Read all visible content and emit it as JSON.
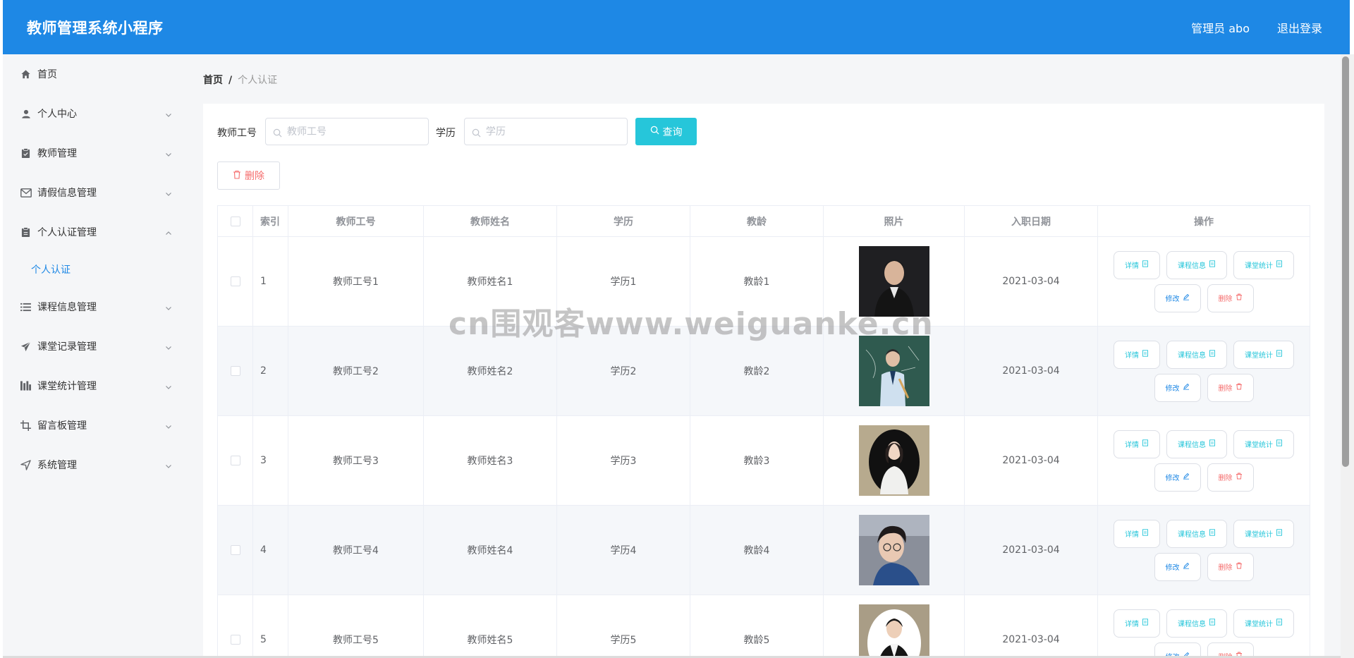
{
  "header": {
    "app_title": "教师管理系统小程序",
    "user_label": "管理员 abo",
    "logout_label": "退出登录",
    "bg_color": "#1e88e5"
  },
  "sidebar": {
    "items": [
      {
        "label": "首页",
        "icon": "home-icon"
      },
      {
        "label": "个人中心",
        "icon": "user-icon"
      },
      {
        "label": "教师管理",
        "icon": "clipboard-icon"
      },
      {
        "label": "请假信息管理",
        "icon": "mail-icon"
      },
      {
        "label": "个人认证管理",
        "icon": "clipboard-icon"
      },
      {
        "label": "课程信息管理",
        "icon": "list-icon"
      },
      {
        "label": "课堂记录管理",
        "icon": "send-icon"
      },
      {
        "label": "课堂统计管理",
        "icon": "bar-chart-icon"
      },
      {
        "label": "留言板管理",
        "icon": "crop-icon"
      },
      {
        "label": "系统管理",
        "icon": "navigation-icon"
      }
    ],
    "submenu_active": "个人认证"
  },
  "breadcrumb": {
    "home": "首页",
    "separator": "/",
    "current": "个人认证"
  },
  "search": {
    "teacher_no_label": "教师工号",
    "teacher_no_placeholder": "教师工号",
    "education_label": "学历",
    "education_placeholder": "学历",
    "query_button": "查询",
    "delete_button": "删除"
  },
  "table": {
    "columns": [
      "索引",
      "教师工号",
      "教师姓名",
      "学历",
      "教龄",
      "照片",
      "入职日期",
      "操作"
    ],
    "rows": [
      {
        "index": "1",
        "teacher_no": "教师工号1",
        "name": "教师姓名1",
        "education": "学历1",
        "teaching_age": "教龄1",
        "date": "2021-03-04"
      },
      {
        "index": "2",
        "teacher_no": "教师工号2",
        "name": "教师姓名2",
        "education": "学历2",
        "teaching_age": "教龄2",
        "date": "2021-03-04"
      },
      {
        "index": "3",
        "teacher_no": "教师工号3",
        "name": "教师姓名3",
        "education": "学历3",
        "teaching_age": "教龄3",
        "date": "2021-03-04"
      },
      {
        "index": "4",
        "teacher_no": "教师工号4",
        "name": "教师姓名4",
        "education": "学历4",
        "teaching_age": "教龄4",
        "date": "2021-03-04"
      },
      {
        "index": "5",
        "teacher_no": "教师工号5",
        "name": "教师姓名5",
        "education": "学历5",
        "teaching_age": "教龄5",
        "date": "2021-03-04"
      }
    ],
    "ops": {
      "detail": "详情",
      "course_info": "课程信息",
      "class_stats": "课堂统计",
      "edit": "修改",
      "delete": "删除"
    }
  },
  "watermark": "cn围观客www.weiguanke.cn",
  "colors": {
    "accent": "#1e88e5",
    "query": "#26c6da",
    "danger": "#f56c6c"
  }
}
